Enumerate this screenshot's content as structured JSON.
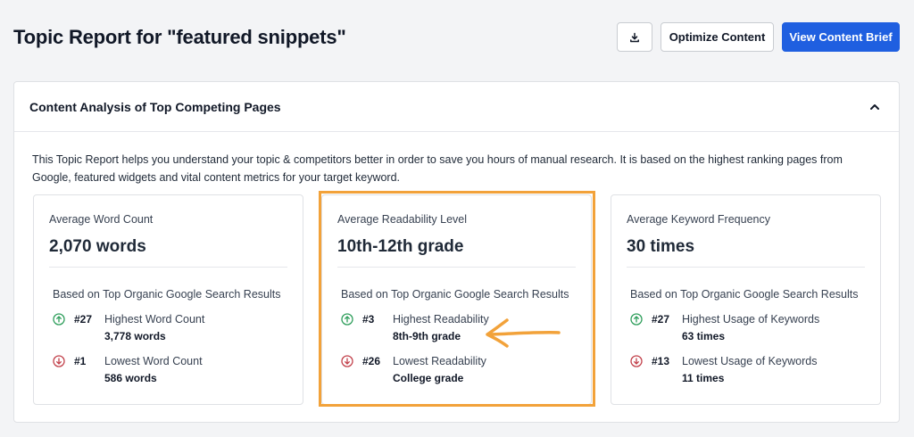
{
  "header": {
    "title": "Topic Report for \"featured snippets\"",
    "buttons": {
      "download_icon": "download-icon",
      "optimize_label": "Optimize Content",
      "brief_label": "View Content Brief"
    }
  },
  "colors": {
    "primary": "#1f5fe0",
    "up": "#2e9e5b",
    "down": "#c2414b",
    "highlight": "#f2a23a"
  },
  "panel": {
    "title": "Content Analysis of Top Competing Pages",
    "collapse_icon": "chevron-up-icon",
    "description": "This Topic Report helps you understand your topic & competitors better in order to save you hours of manual research. It is based on the highest ranking pages from Google, featured widgets and vital content metrics for your target keyword.",
    "cards": [
      {
        "label": "Average Word Count",
        "value": "2,070 words",
        "source": "Based on Top Organic Google Search Results",
        "high": {
          "rank": "#27",
          "title": "Highest Word Count",
          "value": "3,778 words",
          "icon": "arrow-up-circle-icon"
        },
        "low": {
          "rank": "#1",
          "title": "Lowest Word Count",
          "value": "586 words",
          "icon": "arrow-down-circle-icon"
        }
      },
      {
        "label": "Average Readability Level",
        "value": "10th-12th grade",
        "source": "Based on Top Organic Google Search Results",
        "high": {
          "rank": "#3",
          "title": "Highest Readability",
          "value": "8th-9th grade",
          "icon": "arrow-up-circle-icon"
        },
        "low": {
          "rank": "#26",
          "title": "Lowest Readability",
          "value": "College grade",
          "icon": "arrow-down-circle-icon"
        }
      },
      {
        "label": "Average Keyword Frequency",
        "value": "30 times",
        "source": "Based on Top Organic Google Search Results",
        "high": {
          "rank": "#27",
          "title": "Highest Usage of Keywords",
          "value": "63 times",
          "icon": "arrow-up-circle-icon"
        },
        "low": {
          "rank": "#13",
          "title": "Lowest Usage of Keywords",
          "value": "11 times",
          "icon": "arrow-down-circle-icon"
        }
      }
    ]
  }
}
